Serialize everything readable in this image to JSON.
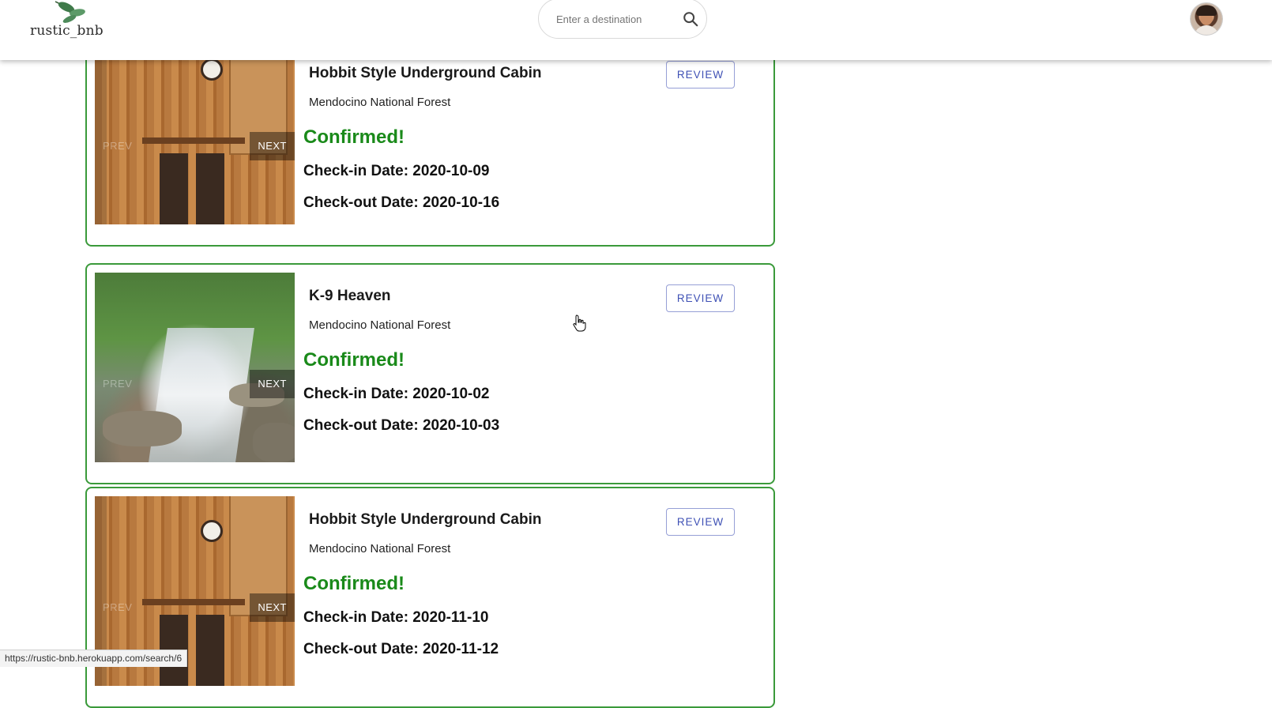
{
  "header": {
    "logo_text": "rustic_bnb",
    "search_placeholder": "Enter a destination"
  },
  "bookings": [
    {
      "title": "Hobbit Style Underground Cabin",
      "location": "Mendocino National Forest",
      "status": "Confirmed!",
      "checkin": "Check-in Date: 2020-10-09",
      "checkout": "Check-out Date: 2020-10-16",
      "review_label": "REVIEW",
      "prev_label": "PREV",
      "next_label": "NEXT"
    },
    {
      "title": "K-9 Heaven",
      "location": "Mendocino National Forest",
      "status": "Confirmed!",
      "checkin": "Check-in Date: 2020-10-02",
      "checkout": "Check-out Date: 2020-10-03",
      "review_label": "REVIEW",
      "prev_label": "PREV",
      "next_label": "NEXT"
    },
    {
      "title": "Hobbit Style Underground Cabin",
      "location": "Mendocino National Forest",
      "status": "Confirmed!",
      "checkin": "Check-in Date: 2020-11-10",
      "checkout": "Check-out Date: 2020-11-12",
      "review_label": "REVIEW",
      "prev_label": "PREV",
      "next_label": "NEXT"
    }
  ],
  "status_bar": {
    "url": "https://rustic-bnb.herokuapp.com/search/6"
  },
  "colors": {
    "confirmed": "#1a8a1a",
    "card_border": "#3a9a3a",
    "review_button": "#3f51b5"
  },
  "icons": [
    "leaf-logo-icon",
    "search-icon",
    "user-avatar",
    "hand-cursor-icon"
  ]
}
